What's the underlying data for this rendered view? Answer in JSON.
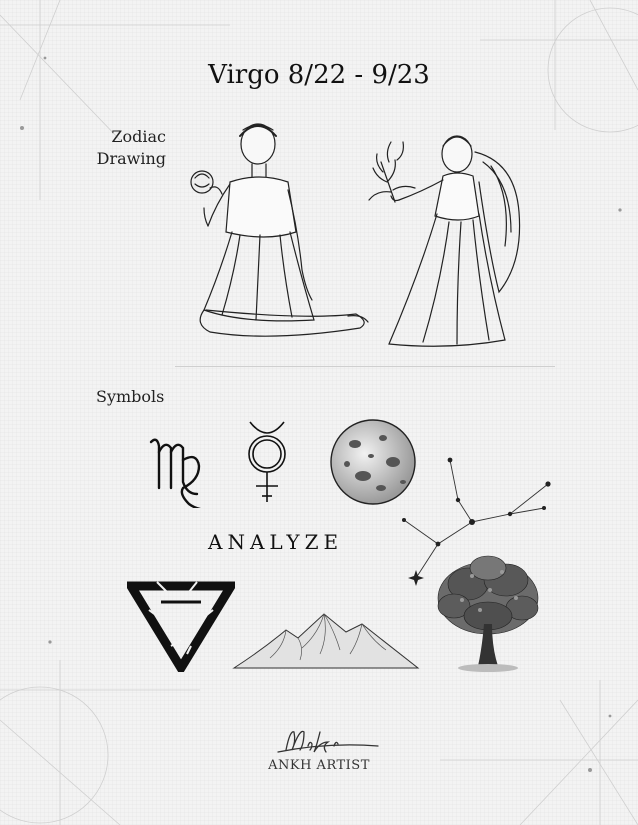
{
  "title": "Virgo 8/22 - 9/23",
  "section_zodiac": {
    "line1": "Zodiac",
    "line2": "Drawing"
  },
  "section_symbols": "Symbols",
  "keyword": "ANALYZE",
  "brand": {
    "signature": "Miki",
    "name": "ANKH ARTIST"
  },
  "colors": {
    "ink": "#111111",
    "paper": "#f3f3f3",
    "line": "#cfcfcf"
  },
  "icons": [
    "virgo-glyph-icon",
    "mercury-symbol-icon",
    "moon-sphere-icon",
    "constellation-icon",
    "earth-triangle-icon",
    "mountains-icon",
    "tree-icon"
  ]
}
